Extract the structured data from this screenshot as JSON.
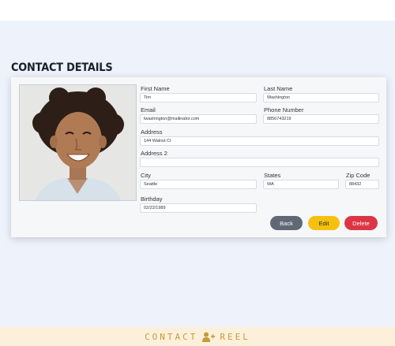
{
  "header": {
    "title": "CONTACT DETAILS"
  },
  "contact": {
    "photo_alt": "contact photo",
    "fields": {
      "first_name": {
        "label": "First Name",
        "value": "Tim"
      },
      "last_name": {
        "label": "Last Name",
        "value": "Washington"
      },
      "email": {
        "label": "Email",
        "value": "twashington@mailinator.com"
      },
      "phone": {
        "label": "Phone Number",
        "value": "8856743219"
      },
      "address": {
        "label": "Address",
        "value": "144 Walnut Ct"
      },
      "address2": {
        "label": "Address 2",
        "value": ""
      },
      "city": {
        "label": "City",
        "value": "Seattle"
      },
      "state": {
        "label": "States",
        "value": "WA"
      },
      "zip": {
        "label": "Zip Code",
        "value": "88432"
      },
      "birthday": {
        "label": "Birthday",
        "value": "02/22/1989"
      }
    }
  },
  "actions": {
    "back": "Back",
    "edit": "Edit",
    "delete": "Delete"
  },
  "footer": {
    "brand_left": "CONTACT",
    "brand_right": "REEL"
  },
  "colors": {
    "back": "#5f6874",
    "edit": "#f6c10e",
    "delete": "#dc3545",
    "background": "#eef3fb",
    "footer": "#fdf0db",
    "brand": "#c49a3a"
  }
}
